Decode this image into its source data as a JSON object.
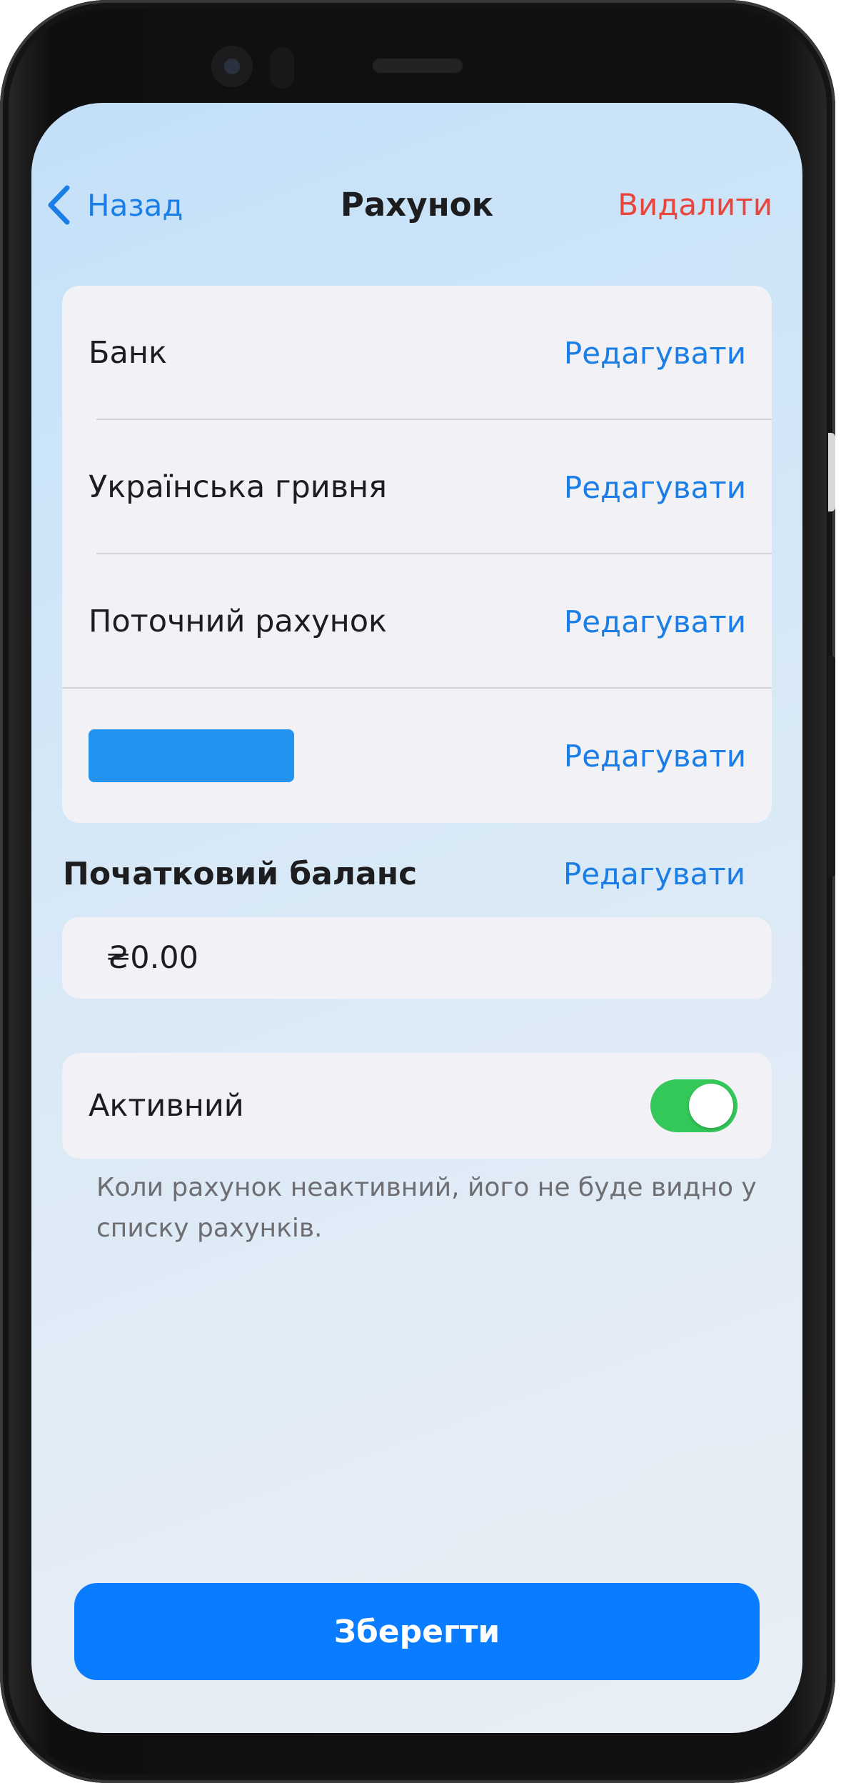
{
  "header": {
    "back_label": "Назад",
    "title": "Рахунок",
    "delete_label": "Видалити"
  },
  "account_rows": [
    {
      "label": "Банк",
      "edit_label": "Редагувати"
    },
    {
      "label": "Українська гривня",
      "edit_label": "Редагувати"
    },
    {
      "label": "Поточний рахунок",
      "edit_label": "Редагувати"
    },
    {
      "label": "",
      "edit_label": "Редагувати",
      "redacted": true
    }
  ],
  "initial_balance": {
    "title": "Початковий баланс",
    "edit_label": "Редагувати",
    "value": "₴0.00"
  },
  "active": {
    "label": "Активний",
    "enabled": true,
    "hint": "Коли рахунок неактивний, його не буде видно у списку рахунків."
  },
  "save_label": "Зберегти",
  "colors": {
    "accent_blue": "#1a7ee6",
    "delete_red": "#e8453c",
    "toggle_green": "#34c759",
    "save_button": "#0a7cff",
    "redaction_block": "#2293ee"
  },
  "icons": {
    "back": "chevron-left-icon"
  }
}
